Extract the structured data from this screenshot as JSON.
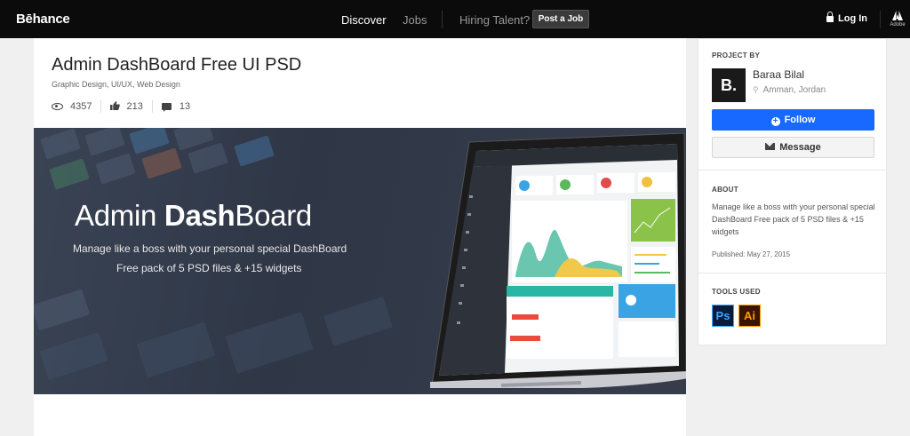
{
  "topbar": {
    "logo": "Bēhance",
    "nav": {
      "discover": "Discover",
      "jobs": "Jobs",
      "hiring": "Hiring Talent?"
    },
    "post_job": "Post a Job",
    "login": "Log In",
    "adobe": "Adobe"
  },
  "project": {
    "title": "Admin DashBoard Free UI PSD",
    "fields": "Graphic Design, UI/UX, Web Design",
    "stats": {
      "views": "4357",
      "appreciations": "213",
      "comments": "13"
    },
    "hero": {
      "title_light": "Admin ",
      "title_bold": "Dash",
      "title_rest": "Board",
      "subtitle_line1": "Manage like a boss with your personal special DashBoard",
      "subtitle_line2": "Free pack of 5 PSD files & +15 widgets"
    }
  },
  "sidebar": {
    "project_by_label": "PROJECT BY",
    "avatar_letter": "B.",
    "owner_name": "Baraa Bilal",
    "owner_location": "Amman, Jordan",
    "follow_label": "Follow",
    "message_label": "Message",
    "about_label": "ABOUT",
    "about_text": "Manage like a boss with your personal special DashBoard Free pack of 5 PSD files & +15 widgets",
    "published": "Published: May 27, 2015",
    "tools_label": "TOOLS USED",
    "tools": [
      "Ps",
      "Ai"
    ]
  },
  "colors": {
    "accent": "#1769ff",
    "topbar": "#0b0b0b"
  }
}
